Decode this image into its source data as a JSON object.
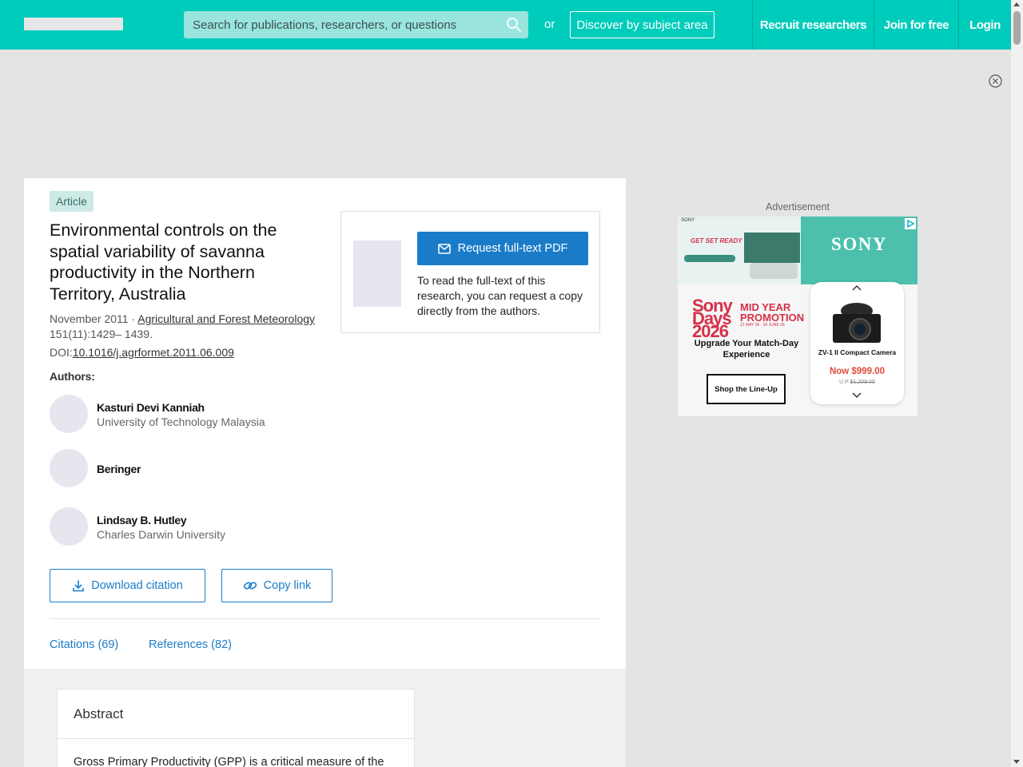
{
  "nav": {
    "search_placeholder": "Search for publications, researchers, or questions",
    "or": "or",
    "discover": "Discover by subject area",
    "recruit": "Recruit researchers",
    "join": "Join for free",
    "login": "Login",
    "brand_color": "#00ccbb"
  },
  "article": {
    "badge": "Article",
    "title": "Environmental controls on the spatial variability of savanna productivity in the Northern Territory, Australia",
    "date": "November 2011",
    "journal": "Agricultural and Forest Meteorology",
    "volume": "151(11):1429– 1439.",
    "doi_label": "DOI:",
    "doi": "10.1016/j.agrformet.2011.06.009",
    "authors_label": "Authors:",
    "authors": [
      {
        "name": "Kasturi Devi Kanniah",
        "affiliation": "University of Technology Malaysia"
      },
      {
        "name": "Beringer",
        "affiliation": ""
      },
      {
        "name": "Lindsay B. Hutley",
        "affiliation": "Charles Darwin University"
      }
    ],
    "download_citation": "Download citation",
    "copy_link": "Copy link",
    "tabs": {
      "citations": "Citations (69)",
      "references": "References (82)"
    }
  },
  "pdf": {
    "request_button": "Request full-text PDF",
    "description": "To read the full-text of this research, you can request a copy directly from the authors."
  },
  "abstract": {
    "heading": "Abstract",
    "body": "Gross Primary Productivity (GPP) is a critical measure of the"
  },
  "ad": {
    "label": "Advertisement",
    "brand": "SONY",
    "top_sony": "SONY",
    "tagline": "GET SET READY",
    "sony_days": "Sony Days 2026",
    "promo": "MID YEAR PROMOTION",
    "dates": "21 MAY 26 - 30 JUNE 26",
    "upgrade": "Upgrade Your Match-Day Experience",
    "shop": "Shop the Line-Up",
    "product_name": "ZV-1 II Compact Camera",
    "price": "Now $999.00",
    "up_label": "U.P",
    "up_price": "$1,209.00"
  }
}
